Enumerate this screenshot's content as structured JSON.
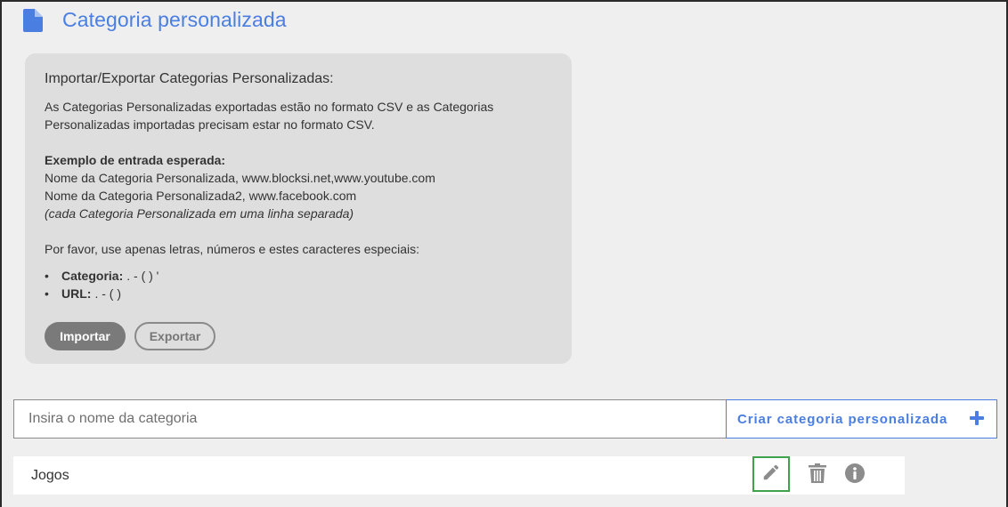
{
  "header": {
    "title": "Categoria personalizada",
    "icon": "document-icon",
    "accent_color": "#4a7ee0"
  },
  "import_export": {
    "title": "Importar/Exportar Categorias Personalizadas:",
    "description_line1": "As Categorias Personalizadas exportadas estão no formato CSV e as Categorias",
    "description_line2": "Personalizadas importadas precisam estar no formato CSV.",
    "example_heading": "Exemplo de entrada esperada:",
    "example_line1": "Nome da Categoria Personalizada, www.blocksi.net,www.youtube.com",
    "example_line2": "Nome da Categoria Personalizada2, www.facebook.com",
    "example_note": "(cada Categoria Personalizada em uma linha separada)",
    "allowed_intro": "Por favor, use apenas letras, números e estes caracteres especiais:",
    "rules": [
      {
        "label": "Categoria:",
        "chars": ". - ( ) '"
      },
      {
        "label": "URL:",
        "chars": ". - ( )"
      }
    ],
    "import_label": "Importar",
    "export_label": "Exportar"
  },
  "create": {
    "placeholder": "Insira o nome da categoria",
    "value": "",
    "button_label": "Criar categoria personalizada",
    "button_icon": "plus-icon"
  },
  "categories": [
    {
      "name": "Jogos",
      "actions": [
        "pencil-icon",
        "trash-icon",
        "info-icon"
      ]
    }
  ],
  "colors": {
    "accent": "#4a7ee0",
    "focus_outline": "#3fa34d",
    "import_button": "#7a7a7a"
  }
}
